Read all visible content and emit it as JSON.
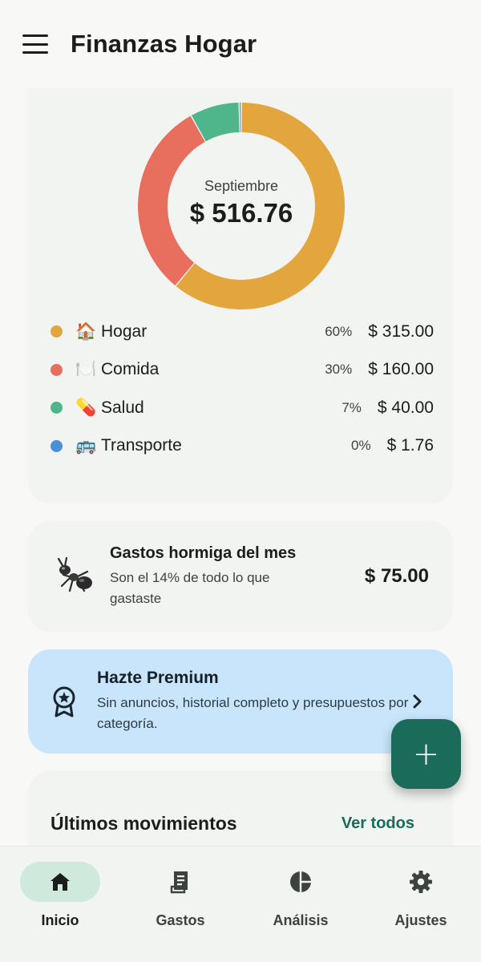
{
  "app": {
    "title": "Finanzas Hogar"
  },
  "summary": {
    "month": "Septiembre",
    "total": "$ 516.76",
    "categories": [
      {
        "emoji": "🏠",
        "name": "Hogar",
        "percent": "60%",
        "amount": "$ 315.00",
        "value": 315.0,
        "color": "#e3a53e"
      },
      {
        "emoji": "🍽️",
        "name": "Comida",
        "percent": "30%",
        "amount": "$ 160.00",
        "value": 160.0,
        "color": "#e86e5e"
      },
      {
        "emoji": "💊",
        "name": "Salud",
        "percent": "7%",
        "amount": "$ 40.00",
        "value": 40.0,
        "color": "#4fb68c"
      },
      {
        "emoji": "🚌",
        "name": "Transporte",
        "percent": "0%",
        "amount": "$ 1.76",
        "value": 1.76,
        "color": "#4a90d9"
      }
    ]
  },
  "hormiga": {
    "title": "Gastos hormiga del mes",
    "subtitle": "Son el 14% de todo lo que gastaste",
    "amount": "$ 75.00"
  },
  "premium": {
    "title": "Hazte Premium",
    "subtitle": "Sin anuncios, historial completo y presupuestos por categoría."
  },
  "movements": {
    "title": "Últimos movimientos",
    "link": "Ver todos"
  },
  "fab": {
    "icon": "plus-icon"
  },
  "nav": [
    {
      "label": "Inicio",
      "icon": "home-icon",
      "active": true
    },
    {
      "label": "Gastos",
      "icon": "receipt-icon",
      "active": false
    },
    {
      "label": "Análisis",
      "icon": "pie-chart-icon",
      "active": false
    },
    {
      "label": "Ajustes",
      "icon": "gear-icon",
      "active": false
    }
  ]
}
